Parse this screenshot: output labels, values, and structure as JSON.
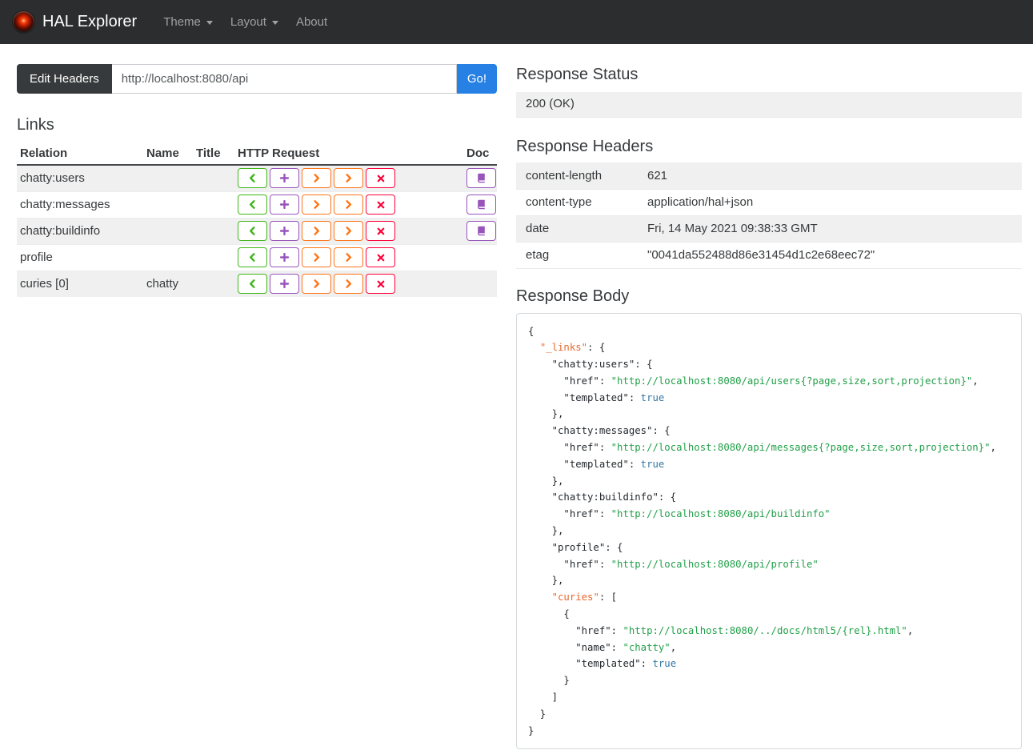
{
  "navbar": {
    "brand": "HAL Explorer",
    "items": [
      {
        "label": "Theme",
        "caret": true
      },
      {
        "label": "Layout",
        "caret": true
      },
      {
        "label": "About",
        "caret": false
      }
    ]
  },
  "request_bar": {
    "edit_headers_label": "Edit Headers",
    "url_value": "http://localhost:8080/api",
    "go_label": "Go!"
  },
  "links": {
    "title": "Links",
    "columns": [
      "Relation",
      "Name",
      "Title",
      "HTTP Request",
      "Doc"
    ],
    "http_buttons": [
      {
        "name": "get-button",
        "icon": "chevron-left",
        "color": "#3fb618"
      },
      {
        "name": "post-button",
        "icon": "plus",
        "color": "#9954bb"
      },
      {
        "name": "put-button",
        "icon": "chevron-right",
        "color": "#ff7518"
      },
      {
        "name": "patch-button",
        "icon": "chevron-right",
        "color": "#ff7518"
      },
      {
        "name": "delete-button",
        "icon": "x",
        "color": "#ff0039"
      }
    ],
    "doc_button": {
      "name": "doc-button",
      "icon": "book",
      "color": "#9954bb"
    },
    "rows": [
      {
        "relation": "chatty:users",
        "name": "",
        "title": "",
        "doc": true
      },
      {
        "relation": "chatty:messages",
        "name": "",
        "title": "",
        "doc": true
      },
      {
        "relation": "chatty:buildinfo",
        "name": "",
        "title": "",
        "doc": true
      },
      {
        "relation": "profile",
        "name": "",
        "title": "",
        "doc": false
      },
      {
        "relation": "curies [0]",
        "name": "chatty",
        "title": "",
        "doc": false
      }
    ]
  },
  "response": {
    "status": {
      "title": "Response Status",
      "value": "200 (OK)"
    },
    "headers": {
      "title": "Response Headers",
      "rows": [
        {
          "key": "content-length",
          "value": "621"
        },
        {
          "key": "content-type",
          "value": "application/hal+json"
        },
        {
          "key": "date",
          "value": "Fri, 14 May 2021 09:38:33 GMT"
        },
        {
          "key": "etag",
          "value": "\"0041da552488d86e31454d1c2e68eec72\""
        }
      ]
    },
    "body": {
      "title": "Response Body",
      "token_colors": {
        "p": "#24292e",
        "k": "#e8682c",
        "s": "#22a049",
        "b": "#3278a6"
      },
      "lines": [
        [
          [
            "p",
            "{"
          ]
        ],
        [
          [
            "p",
            "  "
          ],
          [
            "k",
            "\"_links\""
          ],
          [
            "p",
            ": {"
          ]
        ],
        [
          [
            "p",
            "    \"chatty:users\": {"
          ]
        ],
        [
          [
            "p",
            "      \"href\": "
          ],
          [
            "s",
            "\"http://localhost:8080/api/users{?page,size,sort,projection}\""
          ],
          [
            "p",
            ","
          ]
        ],
        [
          [
            "p",
            "      \"templated\": "
          ],
          [
            "b",
            "true"
          ]
        ],
        [
          [
            "p",
            "    },"
          ]
        ],
        [
          [
            "p",
            "    \"chatty:messages\": {"
          ]
        ],
        [
          [
            "p",
            "      \"href\": "
          ],
          [
            "s",
            "\"http://localhost:8080/api/messages{?page,size,sort,projection}\""
          ],
          [
            "p",
            ","
          ]
        ],
        [
          [
            "p",
            "      \"templated\": "
          ],
          [
            "b",
            "true"
          ]
        ],
        [
          [
            "p",
            "    },"
          ]
        ],
        [
          [
            "p",
            "    \"chatty:buildinfo\": {"
          ]
        ],
        [
          [
            "p",
            "      \"href\": "
          ],
          [
            "s",
            "\"http://localhost:8080/api/buildinfo\""
          ]
        ],
        [
          [
            "p",
            "    },"
          ]
        ],
        [
          [
            "p",
            "    \"profile\": {"
          ]
        ],
        [
          [
            "p",
            "      \"href\": "
          ],
          [
            "s",
            "\"http://localhost:8080/api/profile\""
          ]
        ],
        [
          [
            "p",
            "    },"
          ]
        ],
        [
          [
            "p",
            "    "
          ],
          [
            "k",
            "\"curies\""
          ],
          [
            "p",
            ": ["
          ]
        ],
        [
          [
            "p",
            "      {"
          ]
        ],
        [
          [
            "p",
            "        \"href\": "
          ],
          [
            "s",
            "\"http://localhost:8080/../docs/html5/{rel}.html\""
          ],
          [
            "p",
            ","
          ]
        ],
        [
          [
            "p",
            "        \"name\": "
          ],
          [
            "s",
            "\"chatty\""
          ],
          [
            "p",
            ","
          ]
        ],
        [
          [
            "p",
            "        \"templated\": "
          ],
          [
            "b",
            "true"
          ]
        ],
        [
          [
            "p",
            "      }"
          ]
        ],
        [
          [
            "p",
            "    ]"
          ]
        ],
        [
          [
            "p",
            "  }"
          ]
        ],
        [
          [
            "p",
            "}"
          ]
        ]
      ]
    }
  },
  "colors": {
    "primary": "#2780e3",
    "success": "#3fb618",
    "purple": "#9954bb",
    "warning": "#ff7518",
    "danger": "#ff0039",
    "navbar_bg": "#2b2d2f"
  }
}
